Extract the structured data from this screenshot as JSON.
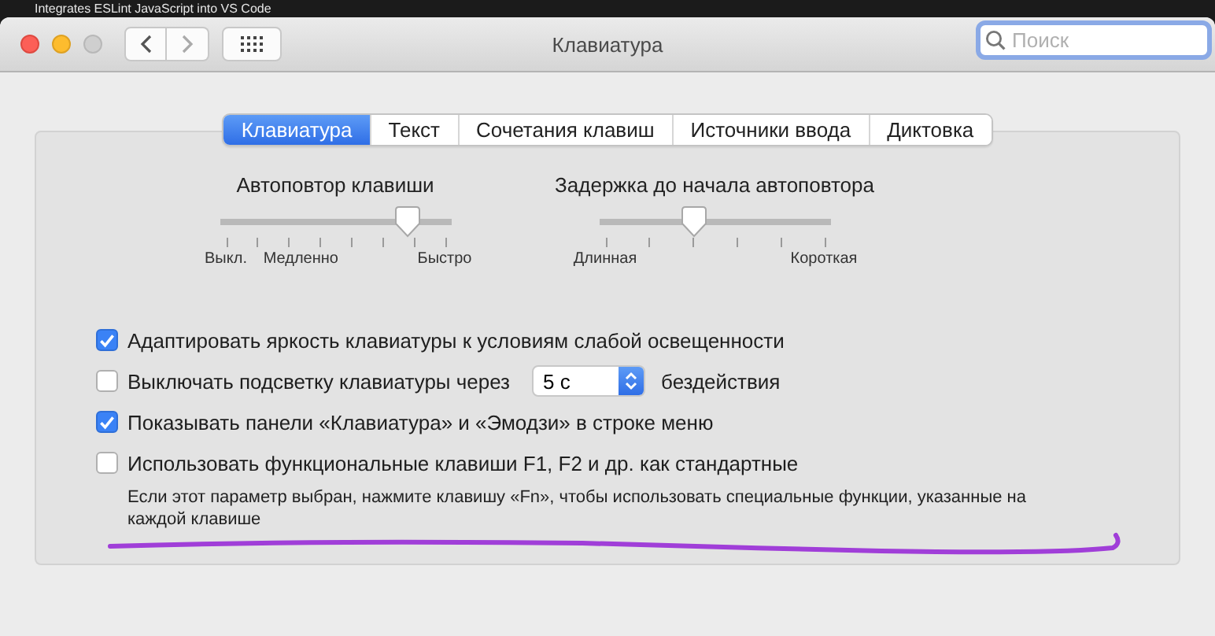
{
  "background_window": {
    "title": "Integrates ESLint JavaScript into VS Code"
  },
  "window": {
    "title": "Клавиатура",
    "search": {
      "placeholder": "Поиск"
    }
  },
  "tabs": [
    {
      "label": "Клавиатура",
      "selected": true
    },
    {
      "label": "Текст",
      "selected": false
    },
    {
      "label": "Сочетания клавиш",
      "selected": false
    },
    {
      "label": "Источники ввода",
      "selected": false
    },
    {
      "label": "Диктовка",
      "selected": false
    }
  ],
  "sliders": [
    {
      "kind": "repeat",
      "title": "Автоповтор клавиши",
      "level": 0.857,
      "labels": [
        "Выкл.",
        "Медленно",
        "Быстро"
      ]
    },
    {
      "kind": "delay",
      "title": "Задержка до начала автоповтора",
      "level": 0.4,
      "labels": [
        "Длинная",
        "Короткая"
      ]
    }
  ],
  "options": [
    {
      "kind": "checkbox",
      "label": "Адаптировать яркость клавиатуры к условиям слабой освещенности",
      "checked": true
    },
    {
      "kind": "popup",
      "label": "Выключать подсветку клавиатуры через",
      "value": "5 с",
      "suffix": "бездействия",
      "checked": false
    },
    {
      "kind": "checkbox",
      "label": "Показывать панели «Клавиатура» и «Эмодзи» в строке меню",
      "checked": true
    },
    {
      "kind": "checkbox",
      "label": "Использовать функциональные клавиши F1, F2 и др. как стандартные",
      "checked": false,
      "hint": "Если этот параметр выбран, нажмите клавишу «Fn», чтобы использовать специальные функции, указанные на каждой клавише"
    }
  ]
}
